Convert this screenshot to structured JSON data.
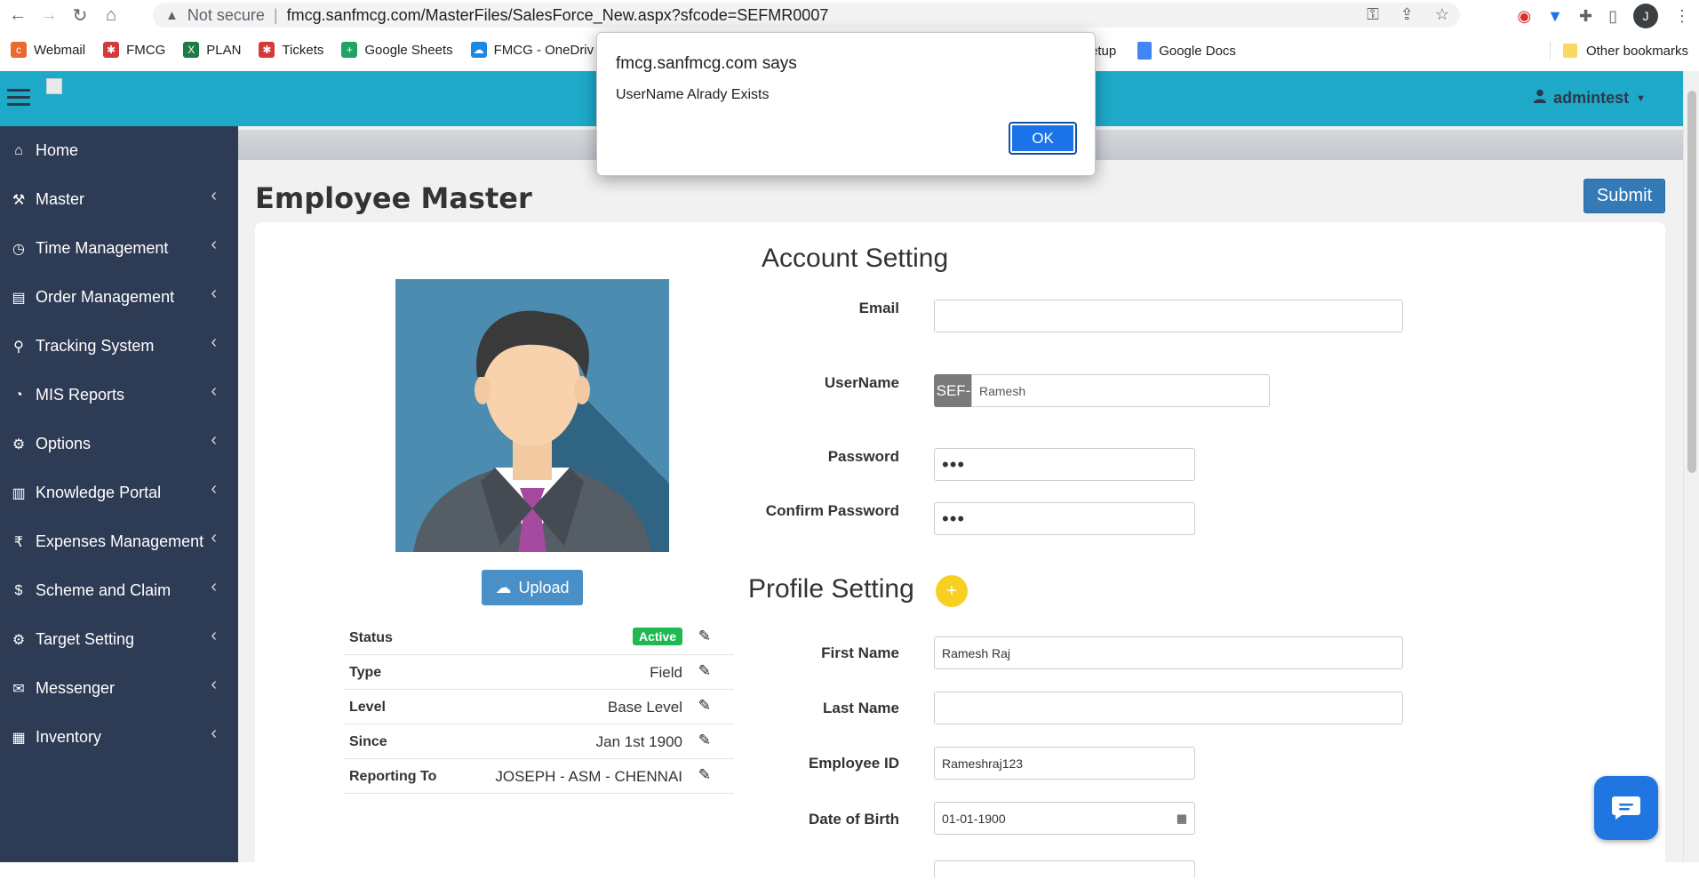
{
  "browser": {
    "security_label": "Not secure",
    "url": "fmcg.sanfmcg.com/MasterFiles/SalesForce_New.aspx?sfcode=SEFMR0007",
    "profile_initial": "J",
    "bookmarks": [
      {
        "label": "Webmail",
        "color": "#e8692b"
      },
      {
        "label": "FMCG",
        "color": "#d53a3a"
      },
      {
        "label": "PLAN",
        "color": "#1e7b45"
      },
      {
        "label": "Tickets",
        "color": "#d53a3a"
      },
      {
        "label": "Google Sheets",
        "color": "#1fa463"
      },
      {
        "label": "FMCG - OneDriv",
        "color": "#1e88e5"
      }
    ],
    "bookmark_partial": "etup",
    "bookmark_docs": "Google Docs",
    "other_bookmarks": "Other bookmarks"
  },
  "alert": {
    "title": "fmcg.sanfmcg.com says",
    "message": "UserName Alrady Exists",
    "ok_label": "OK"
  },
  "header": {
    "user": "admintest"
  },
  "sidebar": {
    "items": [
      {
        "label": "Home",
        "icon": "home-icon",
        "glyph": "⌂",
        "has_chevron": false
      },
      {
        "label": "Master",
        "icon": "gavel-icon",
        "glyph": "⚒",
        "has_chevron": true
      },
      {
        "label": "Time Management",
        "icon": "clock-icon",
        "glyph": "◷",
        "has_chevron": true
      },
      {
        "label": "Order Management",
        "icon": "file-icon",
        "glyph": "▤",
        "has_chevron": true
      },
      {
        "label": "Tracking System",
        "icon": "map-marker-icon",
        "glyph": "⚲",
        "has_chevron": true
      },
      {
        "label": "MIS Reports",
        "icon": "dashboard-icon",
        "glyph": "◔",
        "has_chevron": true
      },
      {
        "label": "Options",
        "icon": "cogs-icon",
        "glyph": "⚙",
        "has_chevron": true
      },
      {
        "label": "Knowledge Portal",
        "icon": "book-icon",
        "glyph": "▥",
        "has_chevron": true
      },
      {
        "label": "Expenses Management",
        "icon": "rupee-icon",
        "glyph": "₹",
        "has_chevron": true
      },
      {
        "label": "Scheme and Claim",
        "icon": "dollar-icon",
        "glyph": "$",
        "has_chevron": true
      },
      {
        "label": "Target Setting",
        "icon": "gear-icon",
        "glyph": "⚙",
        "has_chevron": true
      },
      {
        "label": "Messenger",
        "icon": "comments-icon",
        "glyph": "✉",
        "has_chevron": true
      },
      {
        "label": "Inventory",
        "icon": "list-icon",
        "glyph": "▦",
        "has_chevron": true
      }
    ]
  },
  "page": {
    "title": "Employee Master",
    "submit_label": "Submit",
    "upload_label": "Upload"
  },
  "info": {
    "status_label": "Status",
    "status_value": "Active",
    "rows": [
      {
        "label": "Type",
        "value": "Field"
      },
      {
        "label": "Level",
        "value": "Base Level"
      },
      {
        "label": "Since",
        "value": "Jan 1st 1900"
      },
      {
        "label": "Reporting To",
        "value": "JOSEPH - ASM - CHENNAI"
      }
    ]
  },
  "account": {
    "title": "Account Setting",
    "email_label": "Email",
    "email_value": "",
    "username_label": "UserName",
    "username_prefix": "SEF-",
    "username_value": "Ramesh",
    "password_label": "Password",
    "password_mask": "•••",
    "confirm_label": "Confirm Password",
    "confirm_mask": "•••"
  },
  "profile": {
    "title": "Profile Setting",
    "first_name_label": "First Name",
    "first_name_value": "Ramesh Raj",
    "last_name_label": "Last Name",
    "last_name_value": "",
    "employee_id_label": "Employee ID",
    "employee_id_value": "Rameshraj123",
    "dob_label": "Date of Birth",
    "dob_value": "01-01-1900"
  },
  "colors": {
    "header": "#1ea9c9",
    "sidebar": "#2e3b55",
    "primary": "#337ab7",
    "active_badge": "#1eb854",
    "add_button": "#f7d021",
    "chat": "#1f76e0"
  }
}
